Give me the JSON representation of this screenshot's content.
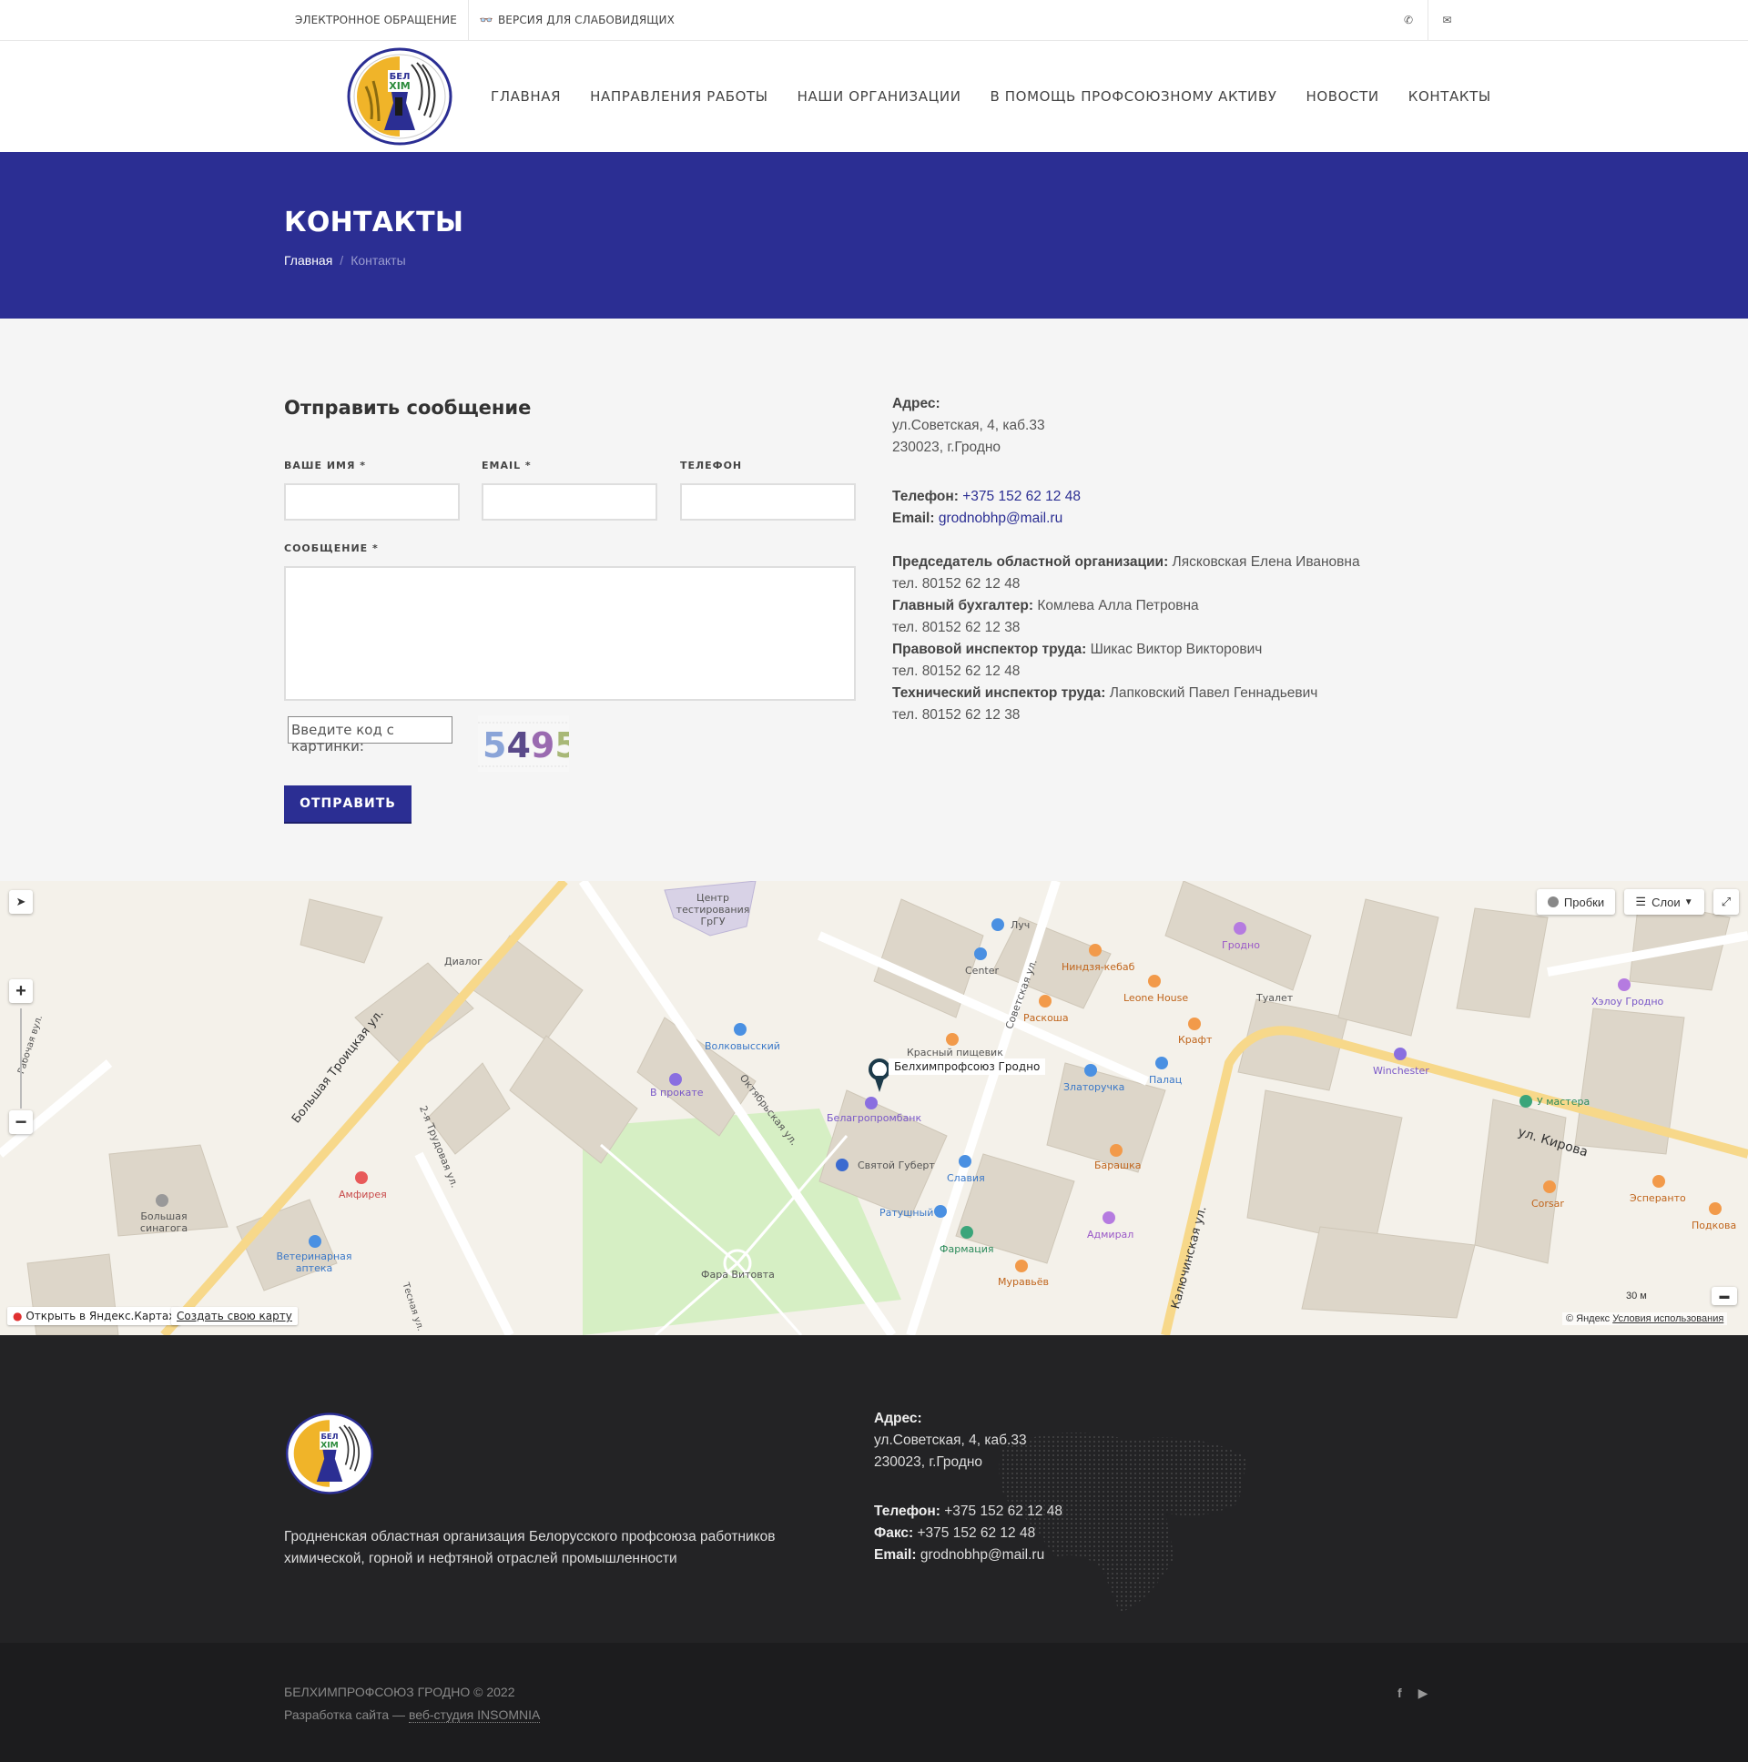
{
  "topbar": {
    "appeal": "ЭЛЕКТРОННОЕ ОБРАЩЕНИЕ",
    "low_vision": "ВЕРСИЯ ДЛЯ СЛАБОВИДЯЩИХ",
    "low_vision_icon": "glasses-icon",
    "phone_icon": "phone-icon",
    "mail_icon": "envelope-icon"
  },
  "logo": {
    "text_top": "БЕЛ",
    "text_bottom": "ХIМ"
  },
  "nav": [
    {
      "label": "ГЛАВНАЯ"
    },
    {
      "label": "НАПРАВЛЕНИЯ РАБОТЫ"
    },
    {
      "label": "НАШИ ОРГАНИЗАЦИИ"
    },
    {
      "label": "В ПОМОЩЬ ПРОФСОЮЗНОМУ АКТИВУ"
    },
    {
      "label": "НОВОСТИ"
    },
    {
      "label": "КОНТАКТЫ"
    }
  ],
  "page": {
    "title": "КОНТАКТЫ",
    "breadcrumb_home": "Главная",
    "breadcrumb_sep": "/",
    "breadcrumb_current": "Контакты"
  },
  "form": {
    "title": "Отправить сообщение",
    "name_label": "ВАШЕ ИМЯ *",
    "email_label": "EMAIL *",
    "phone_label": "ТЕЛЕФОН",
    "message_label": "СООБЩЕНИЕ *",
    "captcha_placeholder": "Введите код с картинки:",
    "captcha_code": "5495",
    "submit": "ОТПРАВИТЬ"
  },
  "contacts": {
    "address_label": "Адрес:",
    "address_line1": "ул.Советская, 4, каб.33",
    "address_line2": "230023, г.Гродно",
    "phone_label": "Телефон:",
    "phone": "+375 152 62 12 48",
    "email_label": "Email:",
    "email": "grodnobhp@mail.ru",
    "staff": [
      {
        "role": "Председатель областной организации:",
        "name": "Лясковская Елена Ивановна",
        "tel": "тел. 80152 62 12 48"
      },
      {
        "role": "Главный бухгалтер:",
        "name": "Комлева Алла Петровна",
        "tel": "тел. 80152 62 12 38"
      },
      {
        "role": "Правовой инспектор труда:",
        "name": "Шикас Виктор Викторович",
        "tel": "тел. 80152 62 12 48"
      },
      {
        "role": "Технический инспектор труда:",
        "name": "Лапковский Павел Геннадьевич",
        "tel": "тел. 80152 62 12 38"
      }
    ]
  },
  "map": {
    "placemark": "Белхимпрофсоюз Гродно",
    "traffic": "Пробки",
    "layers": "Слои",
    "open_link": "Открыть в Яндекс.Картах",
    "create_link": "Создать свою карту",
    "scale": "30 м",
    "copyright": "© Яндекс",
    "terms": "Условия использования",
    "streets": [
      {
        "text": "Большая Троицкая ул."
      },
      {
        "text": "2-я Трудовая ул."
      },
      {
        "text": "Октябрьская ул."
      },
      {
        "text": "Советская ул."
      },
      {
        "text": "Калючинская ул."
      },
      {
        "text": "ул. Кирова"
      },
      {
        "text": "Рабочая вул."
      },
      {
        "text": "Тесная ул."
      }
    ],
    "pois": [
      {
        "text": "Луч"
      },
      {
        "text": "Center"
      },
      {
        "text": "Ниндзя-кебаб"
      },
      {
        "text": "Leone House"
      },
      {
        "text": "Раскоша"
      },
      {
        "text": "Крафт"
      },
      {
        "text": "Гродно"
      },
      {
        "text": "Туалет"
      },
      {
        "text": "Хэлоу Гродно"
      },
      {
        "text": "Winchester"
      },
      {
        "text": "У мастера"
      },
      {
        "text": "Красный пищевик"
      },
      {
        "text": "Златоручка"
      },
      {
        "text": "Палац"
      },
      {
        "text": "Волковысский"
      },
      {
        "text": "В прокате"
      },
      {
        "text": "Белагропромбанк"
      },
      {
        "text": "Святой Губерт"
      },
      {
        "text": "Славия"
      },
      {
        "text": "Барашка"
      },
      {
        "text": "Ратушный"
      },
      {
        "text": "Фармация"
      },
      {
        "text": "Адмирал"
      },
      {
        "text": "Муравьёв"
      },
      {
        "text": "Фара Витовта"
      },
      {
        "text": "Амфирея"
      },
      {
        "text": "Большая синагога"
      },
      {
        "text": "Ветеринарная аптека"
      },
      {
        "text": "Диалог"
      },
      {
        "text": "Центр тестирования ГрГУ"
      },
      {
        "text": "Corsar"
      },
      {
        "text": "Эсперанто"
      },
      {
        "text": "Подкова"
      }
    ]
  },
  "footer": {
    "description": "Гродненская областная организация Белорусского профсоюза работников химической, горной и нефтяной отраслей промышленности",
    "address_label": "Адрес:",
    "address_line1": "ул.Советская, 4, каб.33",
    "address_line2": "230023, г.Гродно",
    "phone_label": "Телефон:",
    "phone": "+375 152 62 12 48",
    "fax_label": "Факс:",
    "fax": "+375 152 62 12 48",
    "email_label": "Email:",
    "email": "grodnobhp@mail.ru",
    "copyright": "БЕЛХИМПРОФСОЮЗ ГРОДНО © 2022",
    "dev_prefix": "Разработка сайта —",
    "dev_studio": "веб-студия INSOMNIA",
    "social": [
      "facebook-icon",
      "youtube-icon"
    ]
  },
  "colors": {
    "brand": "#2b2e93",
    "footer_bg": "#232325",
    "bottom_bg": "#1c1c1e"
  }
}
